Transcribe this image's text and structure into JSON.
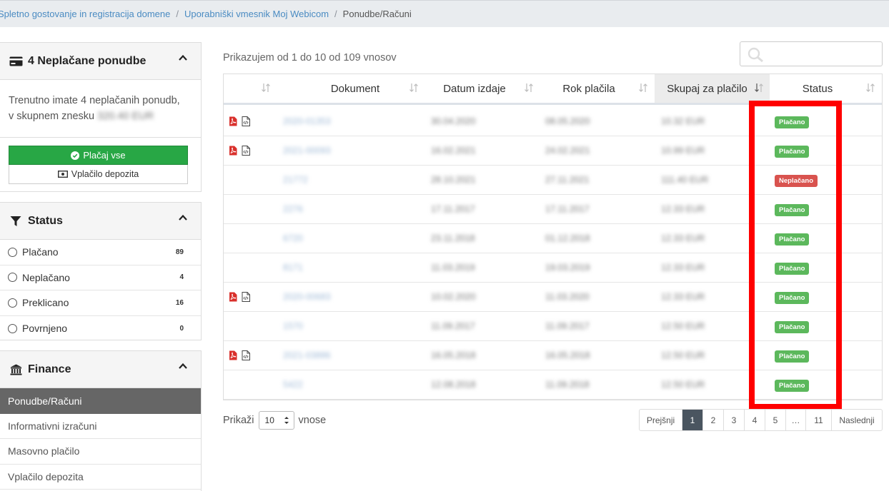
{
  "breadcrumb": [
    {
      "label": "Spletno gostovanje in registracija domene"
    },
    {
      "label": "Uporabniški vmesnik Moj Webicom"
    },
    {
      "label": "Ponudbe/Računi"
    }
  ],
  "unpaid_panel": {
    "title": "4 Neplačane ponudbe",
    "text_line1": "Trenutno imate 4 neplačanih ponudb,",
    "text_line2_prefix": "v skupnem znesku ",
    "text_line2_blurred": "320.40 EUR",
    "pay_all_label": "Plačaj vse",
    "deposit_label": "Vplačilo depozita"
  },
  "status_panel": {
    "title": "Status",
    "items": [
      {
        "label": "Plačano",
        "count": "89"
      },
      {
        "label": "Neplačano",
        "count": "4"
      },
      {
        "label": "Preklicano",
        "count": "16"
      },
      {
        "label": "Povrnjeno",
        "count": "0"
      }
    ]
  },
  "finance_panel": {
    "title": "Finance",
    "items": [
      {
        "label": "Ponudbe/Računi",
        "active": true
      },
      {
        "label": "Informativni izračuni",
        "active": false
      },
      {
        "label": "Masovno plačilo",
        "active": false
      },
      {
        "label": "Vplačilo depozita",
        "active": false
      }
    ]
  },
  "table_info": "Prikazujem od 1 do 10 od 109 vnosov",
  "search": {
    "placeholder": ""
  },
  "columns": [
    "",
    "Dokument",
    "Datum izdaje",
    "Rok plačila",
    "Skupaj za plačilo",
    "Status"
  ],
  "rows": [
    {
      "icons": true,
      "doc": "2020-01353",
      "date": "30.04.2020",
      "due": "08.05.2020",
      "total": "10.32 EUR",
      "status": "Plačano",
      "paid": true
    },
    {
      "icons": true,
      "doc": "2021-00093",
      "date": "16.02.2021",
      "due": "24.02.2021",
      "total": "10.99 EUR",
      "status": "Plačano",
      "paid": true
    },
    {
      "icons": false,
      "doc": "21772",
      "date": "28.10.2021",
      "due": "27.11.2021",
      "total": "111.40 EUR",
      "status": "Neplačano",
      "paid": false
    },
    {
      "icons": false,
      "doc": "2276",
      "date": "17.11.2017",
      "due": "17.11.2017",
      "total": "12.33 EUR",
      "status": "Plačano",
      "paid": true
    },
    {
      "icons": false,
      "doc": "6720",
      "date": "23.11.2018",
      "due": "01.12.2018",
      "total": "12.33 EUR",
      "status": "Plačano",
      "paid": true
    },
    {
      "icons": false,
      "doc": "8171",
      "date": "11.03.2019",
      "due": "19.03.2019",
      "total": "12.33 EUR",
      "status": "Plačano",
      "paid": true
    },
    {
      "icons": true,
      "doc": "2020-00683",
      "date": "10.02.2020",
      "due": "11.03.2020",
      "total": "12.33 EUR",
      "status": "Plačano",
      "paid": true
    },
    {
      "icons": false,
      "doc": "1570",
      "date": "11.09.2017",
      "due": "11.09.2017",
      "total": "12.50 EUR",
      "status": "Plačano",
      "paid": true
    },
    {
      "icons": true,
      "doc": "2021-03886",
      "date": "16.05.2018",
      "due": "16.05.2018",
      "total": "12.50 EUR",
      "status": "Plačano",
      "paid": true
    },
    {
      "icons": false,
      "doc": "5422",
      "date": "12.08.2018",
      "due": "11.09.2018",
      "total": "12.50 EUR",
      "status": "Plačano",
      "paid": true
    }
  ],
  "length_menu": {
    "prefix": "Prikaži",
    "value": "10",
    "suffix": "vnose"
  },
  "pagination": [
    "Prejšnji",
    "1",
    "2",
    "3",
    "4",
    "5",
    "…",
    "11",
    "Naslednji"
  ],
  "pagination_active": "1",
  "colors": {
    "accent_green": "#28a745",
    "badge_paid": "#5cb85c",
    "badge_unpaid": "#d9534f",
    "highlight": "#ff0000",
    "active_nav": "#666666"
  }
}
